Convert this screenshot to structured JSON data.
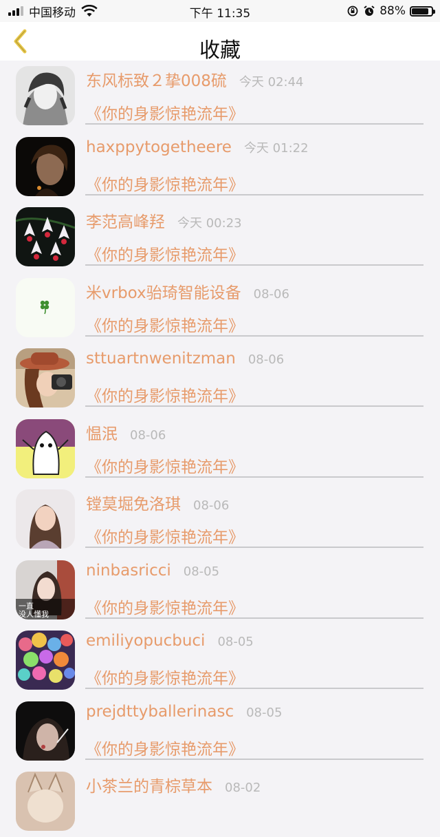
{
  "status_bar": {
    "carrier": "中国移动",
    "time": "下午 11:35",
    "battery_percent": "88%",
    "battery_level": 0.88,
    "icons": [
      "signal-icon",
      "wifi-icon",
      "rotation-lock-icon",
      "alarm-icon",
      "battery-icon"
    ]
  },
  "nav": {
    "title": "收藏",
    "back_icon": "chevron-left-icon",
    "accent_color": "#e8c84a"
  },
  "colors": {
    "name_color": "#e79b6b",
    "time_color": "#b9b9b9",
    "background": "#f4f3f6"
  },
  "favorites": [
    {
      "name": "东风标致２挚008硫",
      "time": "今天 02:44",
      "title": "《你的身影惊艳流年》"
    },
    {
      "name": "haxppytogetheere",
      "time": "今天 01:22",
      "title": "《你的身影惊艳流年》"
    },
    {
      "name": "李范高峰羟",
      "time": "今天 00:23",
      "title": "《你的身影惊艳流年》"
    },
    {
      "name": "米vrbox骀琦智能设备",
      "time": "08-06",
      "title": "《你的身影惊艳流年》"
    },
    {
      "name": "sttuartnwenitzman",
      "time": "08-06",
      "title": "《你的身影惊艳流年》"
    },
    {
      "name": "愠泯",
      "time": "08-06",
      "title": "《你的身影惊艳流年》"
    },
    {
      "name": "镗莫堀免洛琪",
      "time": "08-06",
      "title": "《你的身影惊艳流年》"
    },
    {
      "name": "ninbasricci",
      "time": "08-05",
      "title": "《你的身影惊艳流年》"
    },
    {
      "name": "emiliyopucbuci",
      "time": "08-05",
      "title": "《你的身影惊艳流年》"
    },
    {
      "name": "prejdttyballerinasc",
      "time": "08-05",
      "title": "《你的身影惊艳流年》"
    },
    {
      "name": "小茶兰的青棕草本",
      "time": "08-02",
      "title": ""
    }
  ]
}
